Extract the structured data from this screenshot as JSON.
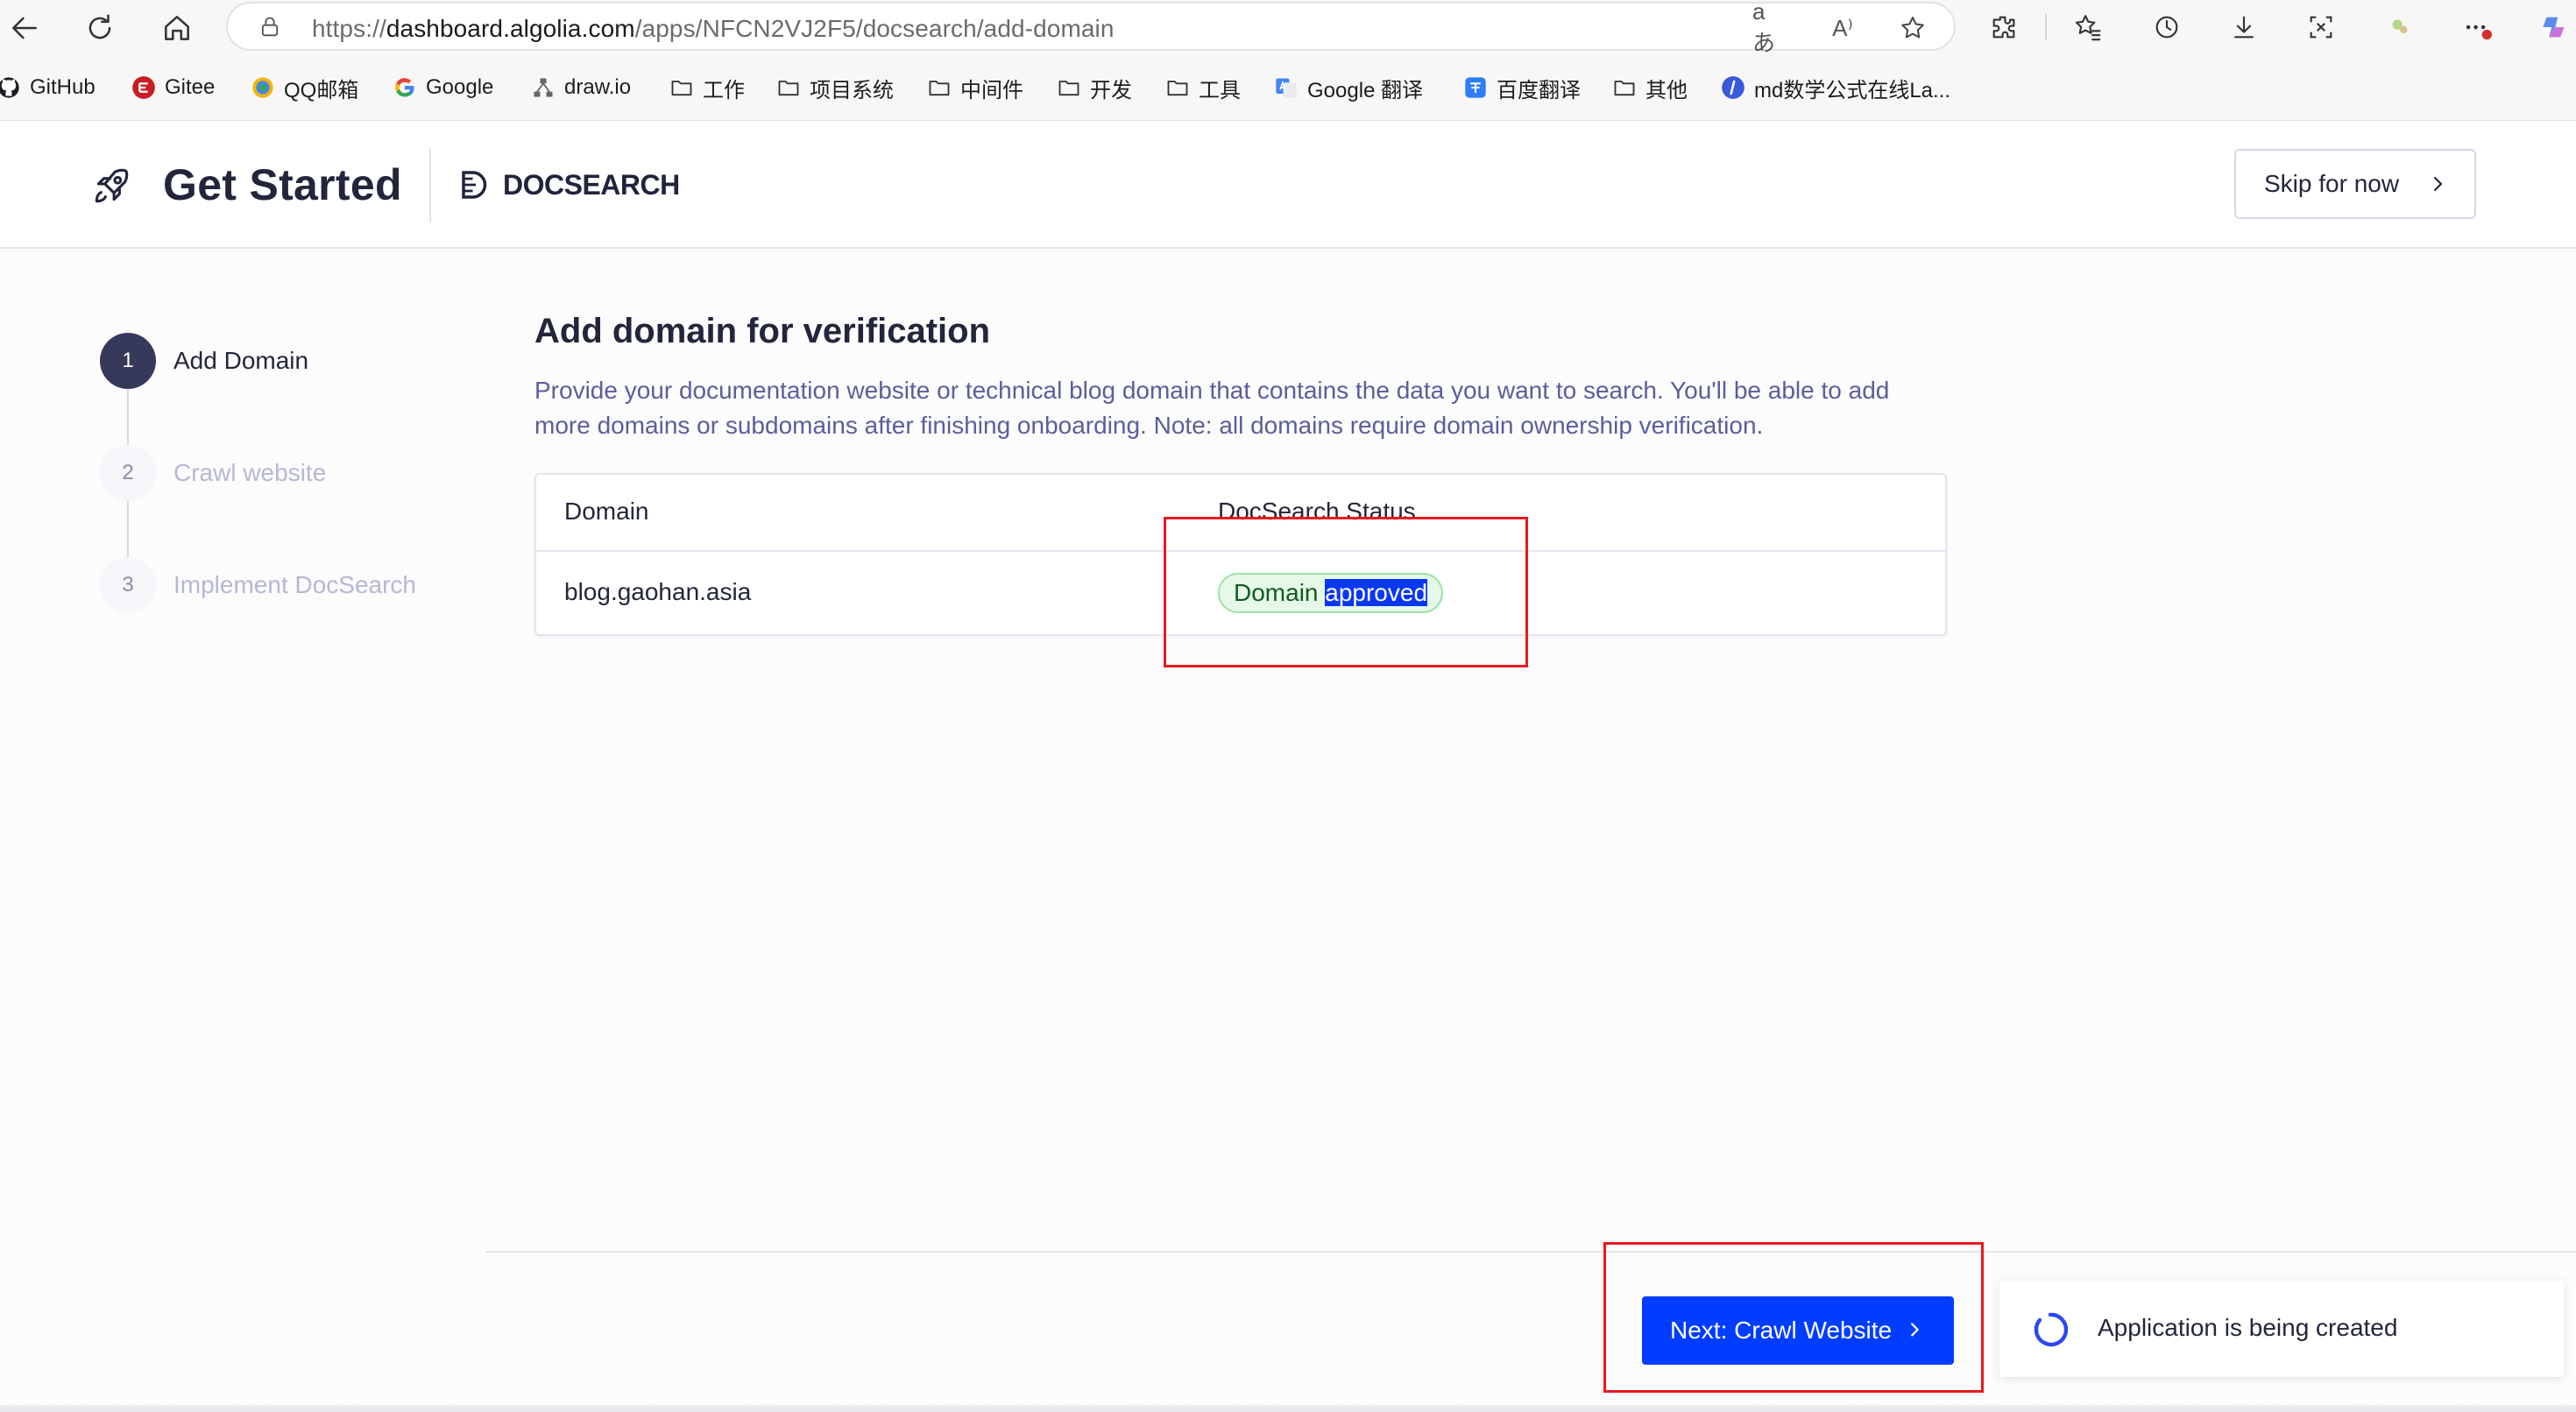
{
  "browser": {
    "url_scheme": "https://",
    "url_host": "dashboard.algolia.com",
    "url_path": "/apps/NFCN2VJ2F5/docsearch/add-domain",
    "translate_glyph": "aあ",
    "read_aloud_glyph": "A⁾"
  },
  "bookmarks": [
    {
      "label": "GitHub",
      "icon": "github-icon"
    },
    {
      "label": "Gitee",
      "icon": "gitee-icon",
      "color": "#c71d23"
    },
    {
      "label": "QQ邮箱",
      "icon": "qq-mail-icon"
    },
    {
      "label": "Google",
      "icon": "google-icon"
    },
    {
      "label": "draw.io",
      "icon": "drawio-icon"
    },
    {
      "label": "工作",
      "icon": "folder-icon"
    },
    {
      "label": "项目系统",
      "icon": "folder-icon"
    },
    {
      "label": "中间件",
      "icon": "folder-icon"
    },
    {
      "label": "开发",
      "icon": "folder-icon"
    },
    {
      "label": "工具",
      "icon": "folder-icon"
    },
    {
      "label": "Google 翻译",
      "icon": "google-translate-icon"
    },
    {
      "label": "百度翻译",
      "icon": "baidu-translate-icon"
    },
    {
      "label": "其他",
      "icon": "folder-icon"
    },
    {
      "label": "md数学公式在线La...",
      "icon": "md-math-icon"
    }
  ],
  "header": {
    "title": "Get Started",
    "product": "DOCSEARCH",
    "skip_label": "Skip for now"
  },
  "steps": [
    {
      "number": "1",
      "label": "Add Domain",
      "state": "active"
    },
    {
      "number": "2",
      "label": "Crawl website",
      "state": "inactive"
    },
    {
      "number": "3",
      "label": "Implement DocSearch",
      "state": "inactive"
    }
  ],
  "main": {
    "title": "Add domain for verification",
    "description": "Provide your documentation website or technical blog domain that contains the data you want to search. You'll be able to add more domains or subdomains after finishing onboarding. Note: all domains require domain ownership verification.",
    "table": {
      "columns": [
        "Domain",
        "DocSearch Status"
      ],
      "rows": [
        {
          "domain": "blog.gaohan.asia",
          "status_prefix": "Domain ",
          "status_selected": "approved"
        }
      ]
    }
  },
  "footer": {
    "next_label": "Next: Crawl Website"
  },
  "toast": {
    "message": "Application is being created"
  },
  "colors": {
    "primary": "#003dff",
    "annotation_red": "#e8191f",
    "badge_green_bg": "#e6f9e9",
    "badge_green_border": "#9be3a7",
    "step_active": "#36395a"
  }
}
